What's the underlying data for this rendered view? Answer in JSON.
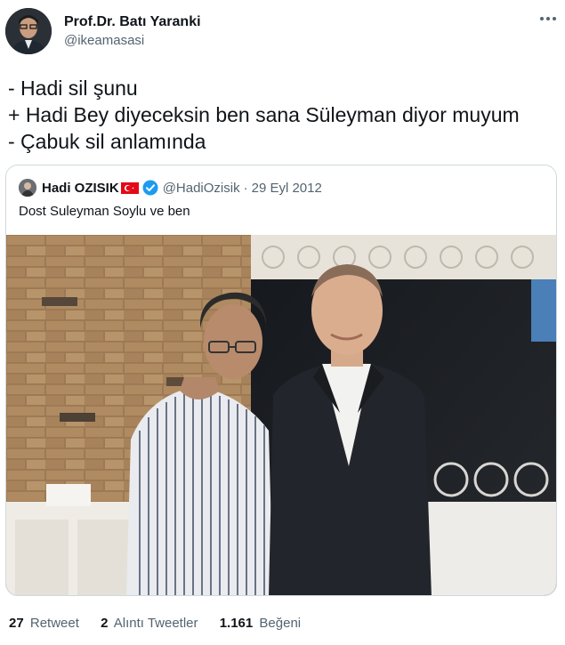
{
  "author": {
    "display_name": "Prof.Dr. Batı Yaranki",
    "handle": "@ikeamasasi",
    "avatar_icon": "person-avatar"
  },
  "more_icon": "more-horizontal-icon",
  "tweet": {
    "lines": [
      "- Hadi sil şunu",
      "+ Hadi Bey diyeceksin ben sana Süleyman diyor muyum",
      "- Çabuk sil anlamında"
    ]
  },
  "quoted": {
    "display_name": "Hadi OZISIK",
    "flag_icon": "turkey-flag-icon",
    "verified_icon": "verified-badge-icon",
    "handle": "@HadiOzisik",
    "separator": "·",
    "date": "29 Eyl 2012",
    "text": "Dost Suleyman Soylu ve ben"
  },
  "stats": {
    "retweets_count": "27",
    "retweets_label": "Retweet",
    "quotes_count": "2",
    "quotes_label": "Alıntı Tweetler",
    "likes_count": "1.161",
    "likes_label": "Beğeni"
  },
  "colors": {
    "verified_blue": "#1d9bf0",
    "text_primary": "#0f1419",
    "text_secondary": "#536471",
    "border": "#cfd9de"
  }
}
